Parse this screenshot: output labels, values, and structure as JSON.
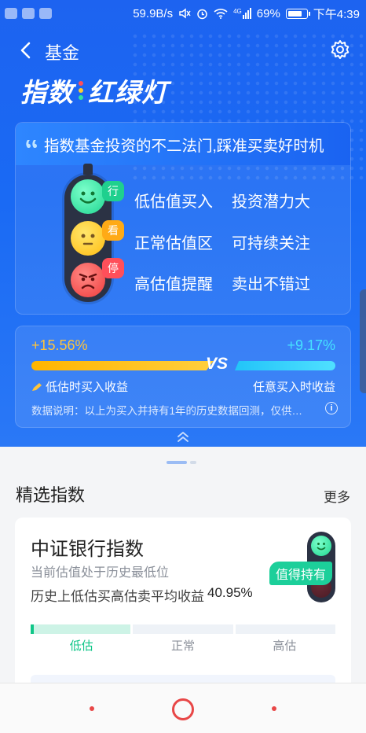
{
  "status_bar": {
    "speed": "59.9B/s",
    "network": "4G",
    "battery": "69%",
    "time": "下午4:39"
  },
  "nav": {
    "title": "基金"
  },
  "hero": {
    "title_left": "指数",
    "title_right": "红绿灯"
  },
  "info_card": {
    "heading": "指数基金投资的不二法门,踩准买卖好时机",
    "tags": [
      "行",
      "看",
      "停"
    ],
    "rows": [
      {
        "a": "低估值买入",
        "b": "投资潜力大"
      },
      {
        "a": "正常估值区",
        "b": "可持续关注"
      },
      {
        "a": "高估值提醒",
        "b": "卖出不错过"
      }
    ]
  },
  "compare": {
    "left_pct": "+15.56%",
    "right_pct": "+9.17%",
    "vs": "VS",
    "left_caption": "低估时买入收益",
    "right_caption": "任意买入时收益",
    "note": "数据说明：以上为买入并持有1年的历史数据回测，仅供…"
  },
  "section": {
    "title": "精选指数",
    "more": "更多"
  },
  "index_card": {
    "name": "中证银行指数",
    "status": "当前估值处于历史最低位",
    "return_label": "历史上低估买高估卖平均收益",
    "return_value": "40.95%",
    "badge": "值得持有",
    "levels": [
      "低估",
      "正常",
      "高估"
    ],
    "current_level": "低估"
  },
  "colors": {
    "hero_blue": "#1d63f0",
    "green": "#10c688",
    "gold": "#ffc43a",
    "cyan": "#46e1ff",
    "red": "#e84747"
  }
}
